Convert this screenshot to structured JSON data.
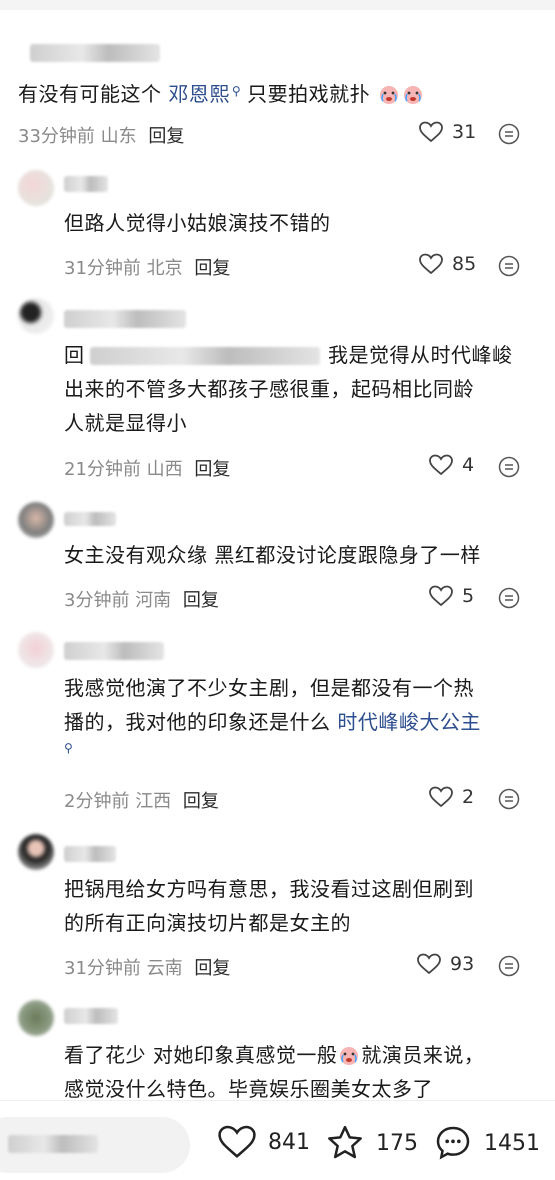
{
  "comments": [
    {
      "text": "有没有可能这个",
      "link": "邓恩熙",
      "text_after": "只要拍戏就扑",
      "time": "33分钟前",
      "location": "山东",
      "reply": "回复",
      "likes": "31"
    },
    {
      "text": "但路人觉得小姑娘演技不错的",
      "time": "31分钟前",
      "location": "北京",
      "reply": "回复",
      "likes": "85"
    },
    {
      "prefix": "回",
      "line1": "我是觉得从时代峰峻",
      "line2": "出来的不管多大都孩子感很重，起码相比同龄",
      "line3": "人就是显得小",
      "time": "21分钟前",
      "location": "山西",
      "reply": "回复",
      "likes": "4"
    },
    {
      "text": "女主没有观众缘 黑红都没讨论度跟隐身了一样",
      "time": "3分钟前",
      "location": "河南",
      "reply": "回复",
      "likes": "5"
    },
    {
      "line1": "我感觉他演了不少女主剧，但是都没有一个热",
      "line2": "播的，我对他的印象还是什么",
      "link": "时代峰峻大公主",
      "time": "2分钟前",
      "location": "江西",
      "reply": "回复",
      "likes": "2"
    },
    {
      "line1": "把锅甩给女方吗有意思，我没看过这剧但刷到",
      "line2": "的所有正向演技切片都是女主的",
      "time": "31分钟前",
      "location": "云南",
      "reply": "回复",
      "likes": "93"
    },
    {
      "line1a": "看了花少 对她印象真感觉一般",
      "line1b": "就演员来说，",
      "line2": "感觉没什么特色。毕竟娱乐圈美女太多了"
    }
  ],
  "bottom_bar": {
    "likes": "841",
    "favorites": "175",
    "comments": "1451"
  },
  "colors": {
    "link": "#2c4d8e",
    "meta": "#8a8a8a"
  }
}
